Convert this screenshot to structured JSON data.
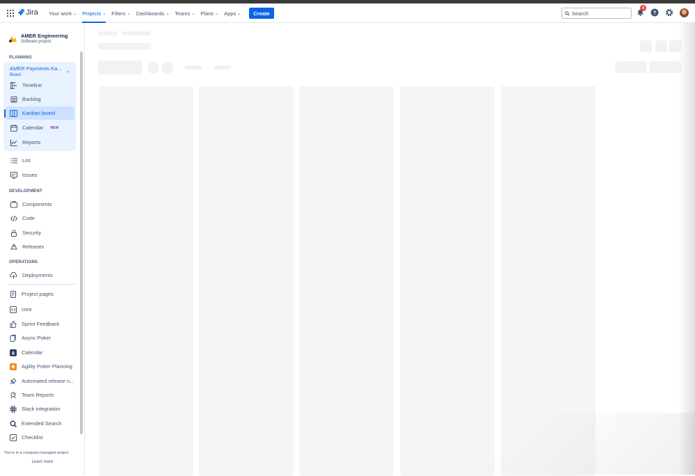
{
  "topnav": {
    "logo_text": "Jira",
    "items": [
      {
        "label": "Your work",
        "active": false
      },
      {
        "label": "Projects",
        "active": true
      },
      {
        "label": "Filters",
        "active": false
      },
      {
        "label": "Dashboards",
        "active": false
      },
      {
        "label": "Teams",
        "active": false
      },
      {
        "label": "Plans",
        "active": false
      },
      {
        "label": "Apps",
        "active": false
      }
    ],
    "create_label": "Create",
    "search_placeholder": "Search",
    "notification_count": "4",
    "accent_color": "#0C66E4"
  },
  "sidebar": {
    "project_name": "AMER Engineering",
    "project_type": "Software project",
    "planning_header": "PLANNING",
    "board_name": "AMER Payments Ka...",
    "board_type": "Board",
    "planning_items": [
      {
        "label": "Timeline",
        "icon": "timeline-icon"
      },
      {
        "label": "Backlog",
        "icon": "backlog-icon"
      },
      {
        "label": "Kanban board",
        "icon": "board-icon",
        "selected": true
      },
      {
        "label": "Calendar",
        "icon": "calendar-icon",
        "lozenge": "NEW"
      },
      {
        "label": "Reports",
        "icon": "reports-icon"
      }
    ],
    "other_items": [
      {
        "label": "List",
        "icon": "list-icon"
      },
      {
        "label": "Issues",
        "icon": "issues-icon"
      }
    ],
    "development_header": "DEVELOPMENT",
    "development_items": [
      {
        "label": "Components",
        "icon": "components-icon"
      },
      {
        "label": "Code",
        "icon": "code-icon"
      },
      {
        "label": "Security",
        "icon": "lock-icon"
      },
      {
        "label": "Releases",
        "icon": "ship-icon"
      }
    ],
    "operations_header": "OPERATIONS",
    "operations_items": [
      {
        "label": "Deployments",
        "icon": "cloud-upload-icon"
      }
    ],
    "app_items": [
      {
        "label": "Project pages",
        "icon": "page-icon"
      },
      {
        "label": "core",
        "icon": "code-block-icon"
      },
      {
        "label": "Sprint Feedback",
        "icon": "thumbs-up-icon"
      },
      {
        "label": "Async Poker",
        "icon": "cards-icon"
      },
      {
        "label": "Calendar",
        "icon": "calendar-app-icon"
      },
      {
        "label": "Agility Poker Planning",
        "icon": "poker-icon"
      },
      {
        "label": "Automated release n...",
        "icon": "release-notes-icon"
      },
      {
        "label": "Team Reports",
        "icon": "team-reports-icon"
      },
      {
        "label": "Slack integration",
        "icon": "slack-icon"
      },
      {
        "label": "Extended Search",
        "icon": "extended-search-icon"
      },
      {
        "label": "Checklist",
        "icon": "checklist-icon"
      }
    ],
    "footer_note": "You're in a company-managed project",
    "learn_more": "Learn more"
  }
}
